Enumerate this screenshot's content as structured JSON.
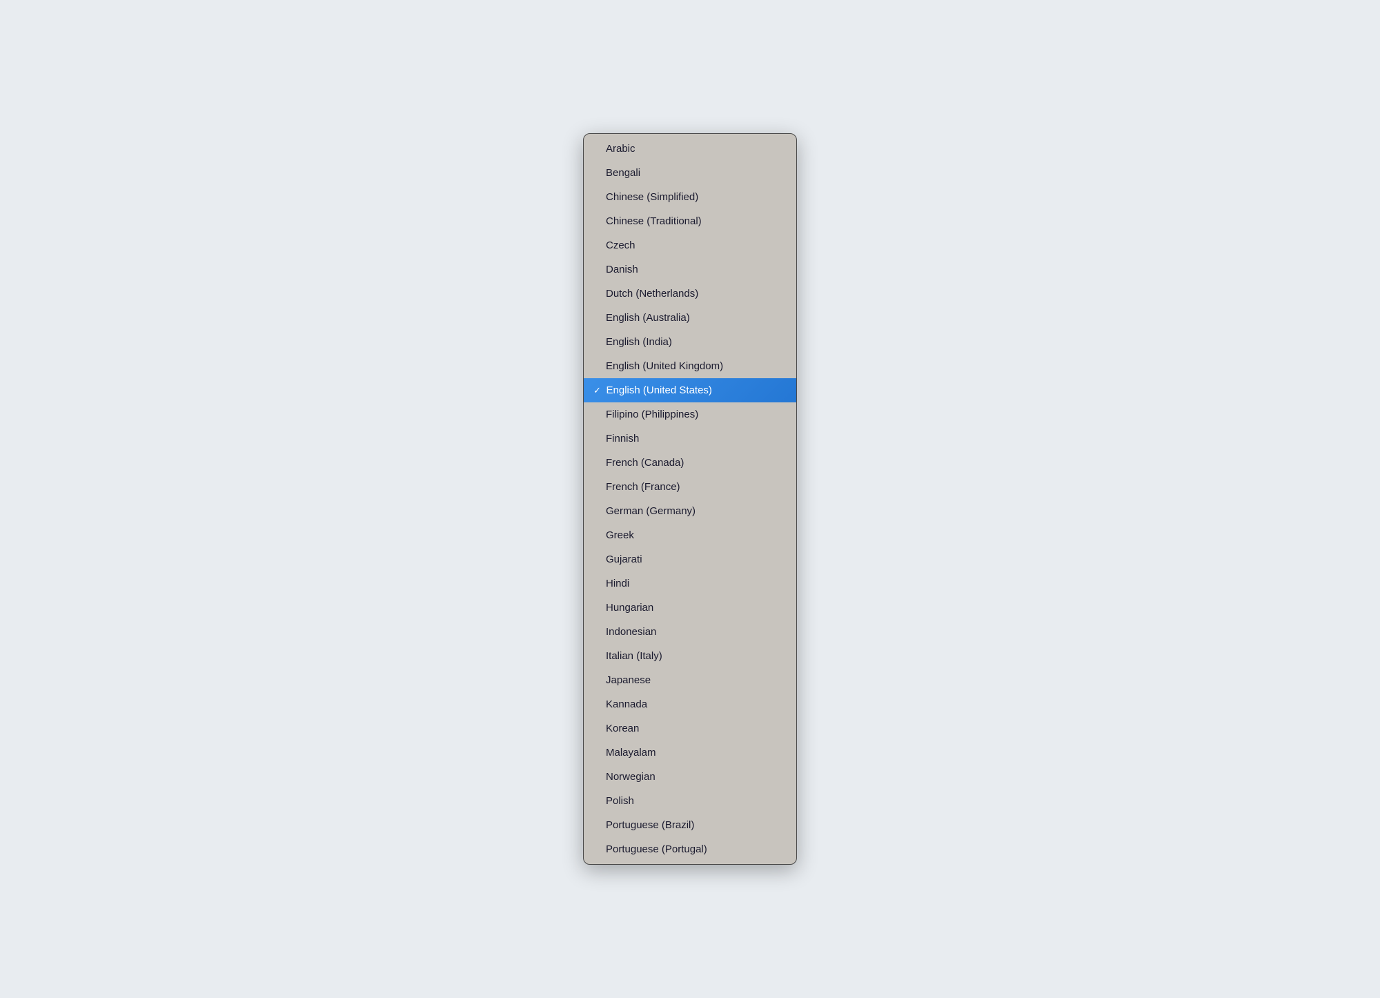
{
  "dropdown": {
    "items": [
      {
        "id": "arabic",
        "label": "Arabic",
        "selected": false
      },
      {
        "id": "bengali",
        "label": "Bengali",
        "selected": false
      },
      {
        "id": "chinese-simplified",
        "label": "Chinese (Simplified)",
        "selected": false
      },
      {
        "id": "chinese-traditional",
        "label": "Chinese (Traditional)",
        "selected": false
      },
      {
        "id": "czech",
        "label": "Czech",
        "selected": false
      },
      {
        "id": "danish",
        "label": "Danish",
        "selected": false
      },
      {
        "id": "dutch-netherlands",
        "label": "Dutch (Netherlands)",
        "selected": false
      },
      {
        "id": "english-australia",
        "label": "English (Australia)",
        "selected": false
      },
      {
        "id": "english-india",
        "label": "English (India)",
        "selected": false
      },
      {
        "id": "english-uk",
        "label": "English (United Kingdom)",
        "selected": false
      },
      {
        "id": "english-us",
        "label": "English (United States)",
        "selected": true
      },
      {
        "id": "filipino-philippines",
        "label": "Filipino (Philippines)",
        "selected": false
      },
      {
        "id": "finnish",
        "label": "Finnish",
        "selected": false
      },
      {
        "id": "french-canada",
        "label": "French (Canada)",
        "selected": false
      },
      {
        "id": "french-france",
        "label": "French (France)",
        "selected": false
      },
      {
        "id": "german-germany",
        "label": "German (Germany)",
        "selected": false
      },
      {
        "id": "greek",
        "label": "Greek",
        "selected": false
      },
      {
        "id": "gujarati",
        "label": "Gujarati",
        "selected": false
      },
      {
        "id": "hindi",
        "label": "Hindi",
        "selected": false
      },
      {
        "id": "hungarian",
        "label": "Hungarian",
        "selected": false
      },
      {
        "id": "indonesian",
        "label": "Indonesian",
        "selected": false
      },
      {
        "id": "italian-italy",
        "label": "Italian (Italy)",
        "selected": false
      },
      {
        "id": "japanese",
        "label": "Japanese",
        "selected": false
      },
      {
        "id": "kannada",
        "label": "Kannada",
        "selected": false
      },
      {
        "id": "korean",
        "label": "Korean",
        "selected": false
      },
      {
        "id": "malayalam",
        "label": "Malayalam",
        "selected": false
      },
      {
        "id": "norwegian",
        "label": "Norwegian",
        "selected": false
      },
      {
        "id": "polish",
        "label": "Polish",
        "selected": false
      },
      {
        "id": "portuguese-brazil",
        "label": "Portuguese (Brazil)",
        "selected": false
      },
      {
        "id": "portuguese-portugal",
        "label": "Portuguese (Portugal)",
        "selected": false
      }
    ],
    "check_symbol": "✓"
  }
}
